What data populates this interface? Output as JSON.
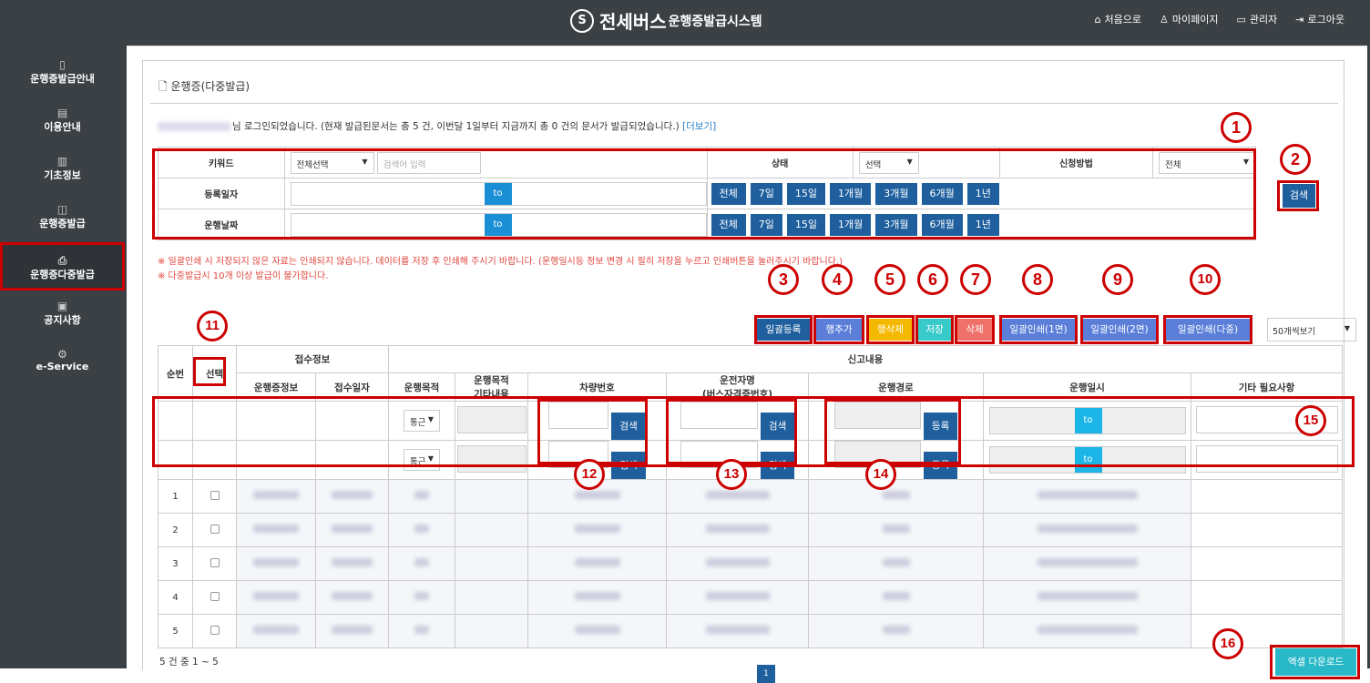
{
  "header": {
    "logo_mark": "S",
    "brand": "전세버스",
    "system_name": "운행증발급시스템",
    "nav": [
      {
        "icon": "home-icon",
        "label": "처음으로"
      },
      {
        "icon": "user-icon",
        "label": "마이페이지"
      },
      {
        "icon": "monitor-icon",
        "label": "관리자"
      },
      {
        "icon": "logout-icon",
        "label": "로그아웃"
      }
    ]
  },
  "sidebar": {
    "items": [
      {
        "icon": "document-icon",
        "label": "운행증발급안내"
      },
      {
        "icon": "list-icon",
        "label": "이용안내"
      },
      {
        "icon": "file-icon",
        "label": "기초정보"
      },
      {
        "icon": "box-icon",
        "label": "운행증발급"
      },
      {
        "icon": "printer-icon",
        "label": "운행증다중발급",
        "active": true
      },
      {
        "icon": "clipboard-icon",
        "label": "공지사항"
      },
      {
        "icon": "gear-icon",
        "label": "e-Service"
      }
    ]
  },
  "page": {
    "title": "운행증(다중발급)",
    "notice_prefix": "님 로그인되었습니다. (현재 발급된문서는 총 5 건, 이번달 1일부터 지금까지 총 0 건의 문서가 발급되었습니다.)",
    "notice_link": "[더보기]"
  },
  "search": {
    "keyword_label": "키워드",
    "keyword_select": "전체선택",
    "keyword_placeholder": "검색어 입력",
    "status_label": "상태",
    "status_select": "선택",
    "method_label": "신청방법",
    "method_select": "전체",
    "reg_date_label": "등록일자",
    "run_date_label": "운행날짜",
    "to": "to",
    "periods": [
      "전체",
      "7일",
      "15일",
      "1개월",
      "3개월",
      "6개월",
      "1년"
    ],
    "search_button": "검색"
  },
  "warnings": [
    "※ 일괄인쇄 시 저장되지 않은 자료는 인쇄되지 않습니다. 데이터를 저장 후 인쇄해 주시기 바랍니다. (운행일시등 정보 변경 시 필히 저장을 누르고 인쇄버튼을 눌러주시기 바랍니다.)",
    "※ 다중발급시 10개 이상 발급이 불가합니다."
  ],
  "actions": {
    "bulk_register": "일괄등록",
    "add_row": "행추가",
    "delete_row": "행삭제",
    "save": "저장",
    "delete": "삭제",
    "print1": "일괄인쇄(1면)",
    "print2": "일괄인쇄(2면)",
    "print_multi": "일괄인쇄(다중)",
    "page_size": "50개씩보기",
    "colors": {
      "blue": "#5b7fd9",
      "orange": "#f5b800",
      "teal": "#38c9c9",
      "red": "#f0706a",
      "navy": "#1f5f9e"
    }
  },
  "table": {
    "col_no": "순번",
    "col_select": "선택",
    "group_receipt": "접수정보",
    "group_report": "신고내용",
    "col_permit_info": "운행증정보",
    "col_receipt_date": "접수일자",
    "col_purpose": "운행목적",
    "col_purpose_etc_1": "운행목적",
    "col_purpose_etc_2": "기타내용",
    "col_vehicle": "차량번호",
    "col_driver_1": "운전자명",
    "col_driver_2": "(버스자격증번호)",
    "col_route": "운행경로",
    "col_datetime": "운행일시",
    "col_etc": "기타 필요사항",
    "input_purpose": "통근",
    "search_btn": "검색",
    "register_btn": "등록",
    "to": "to",
    "rows": [
      "1",
      "2",
      "3",
      "4",
      "5"
    ]
  },
  "footer": {
    "count": "5 건 중 1 ~ 5",
    "page": "1",
    "excel": "엑셀 다운로드"
  },
  "markers": [
    "1",
    "2",
    "3",
    "4",
    "5",
    "6",
    "7",
    "8",
    "9",
    "10",
    "11",
    "12",
    "13",
    "14",
    "15",
    "16"
  ]
}
